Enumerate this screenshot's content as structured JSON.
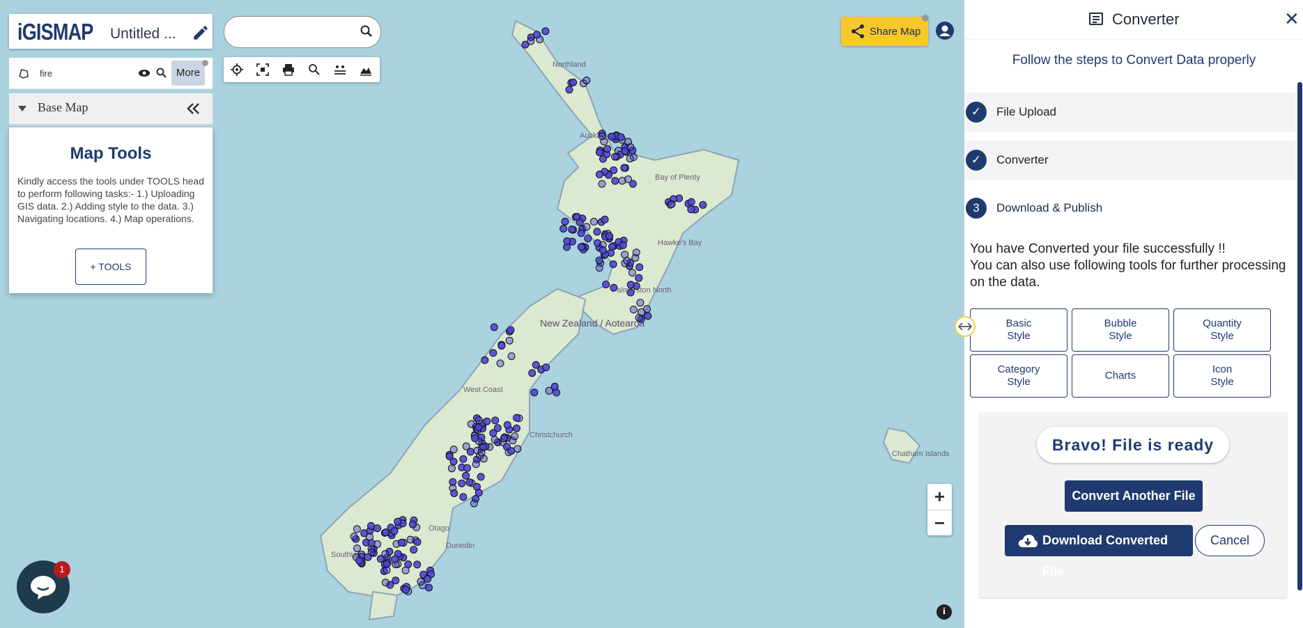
{
  "app": {
    "logo": "iGISMAP",
    "map_title": "Untitled ...",
    "edit_icon": "pencil-icon"
  },
  "layer": {
    "name": "fire",
    "more_label": "More",
    "icons": [
      "layer-shape-icon",
      "eye-icon",
      "zoom-to-layer-icon"
    ]
  },
  "basemap": {
    "label": "Base Map",
    "collapse_icon": "double-chevron-left-icon"
  },
  "map_tools": {
    "title": "Map Tools",
    "description": "Kindly access the tools under TOOLS head to perform following tasks:- 1.) Uploading GIS data. 2.) Adding style to the data. 3.) Navigating locations. 4.) Map operations.",
    "button_label": "+ TOOLS"
  },
  "search": {
    "placeholder": "",
    "icon": "search-icon"
  },
  "toolbar": {
    "icons": [
      "locate-icon",
      "fullscreen-icon",
      "print-icon",
      "search-icon",
      "measure-icon",
      "elevation-icon"
    ]
  },
  "header": {
    "share_label": "Share Map",
    "share_icon": "share-icon",
    "user_icon": "user-icon"
  },
  "map": {
    "labels": [
      "Northland",
      "Auckland",
      "Bay of Plenty",
      "Hawke's Bay",
      "Palmerston North",
      "New Zealand / Aotearoa",
      "West Coast",
      "Christchurch",
      "Otago",
      "Dunedin",
      "Southland",
      "Chatham Islands"
    ],
    "zoom_in": "+",
    "zoom_out": "−",
    "info": "i",
    "chat_badge": "1",
    "colors": {
      "point_fill": "#4b47d6",
      "point_stroke": "#111111",
      "water": "#aad3df",
      "land": "#dbe9d0"
    }
  },
  "panel": {
    "title": "Converter",
    "close": "✕",
    "subtitle": "Follow the steps to Convert Data properly",
    "steps": [
      {
        "label": "File Upload",
        "marker": "✓",
        "state": "done"
      },
      {
        "label": "Converter",
        "marker": "✓",
        "state": "done"
      },
      {
        "label": "Download & Publish",
        "marker": "3",
        "state": "active"
      }
    ],
    "success_line1": "You have Converted your file successfully !!",
    "success_line2": "You can also use following tools for further processing on the data.",
    "style_buttons": [
      "Basic\nStyle",
      "Bubble\nStyle",
      "Quantity\nStyle",
      "Category\nStyle",
      "Charts",
      "Icon\nStyle"
    ],
    "ready_text": "Bravo! File is ready",
    "convert_another": "Convert Another File",
    "download_label": "Download Converted File",
    "cancel_label": "Cancel"
  }
}
